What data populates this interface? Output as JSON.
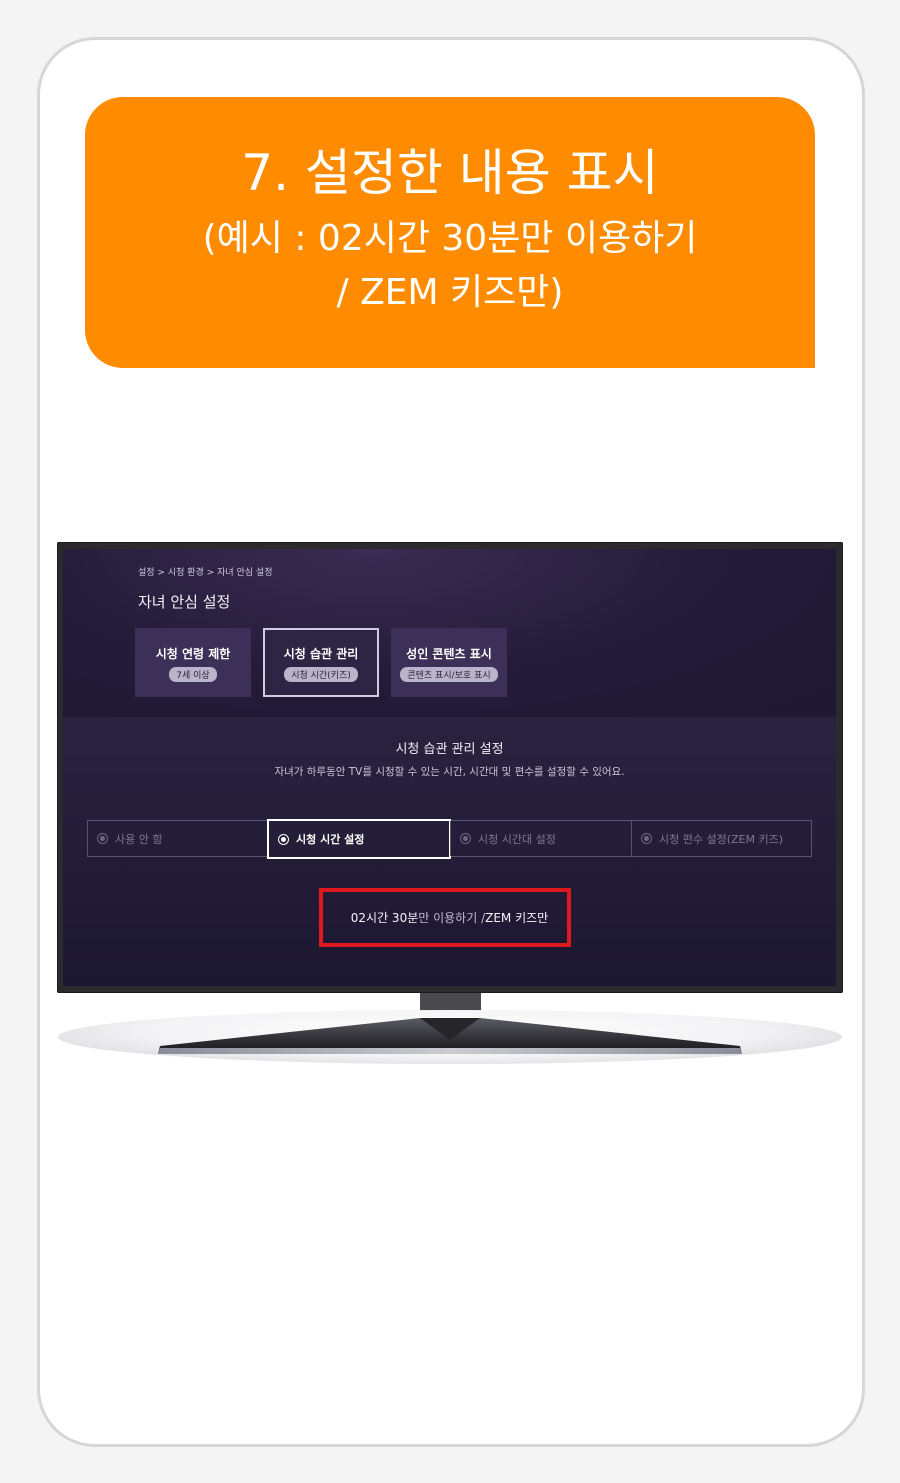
{
  "banner": {
    "line1": "7. 설정한 내용 표시",
    "line2": "(예시 : 02시간 30분만 이용하기",
    "line3": "/ ZEM 키즈만)",
    "color": "#ff8c00"
  },
  "tv": {
    "breadcrumb": "설정 > 시청 환경 > 자녀 안심 설정",
    "page_title": "자녀 안심 설정",
    "categories": [
      {
        "label": "시청 연령 제한",
        "sub": "7세 이상"
      },
      {
        "label": "시청 습관 관리",
        "sub": "시청 시간(키즈)"
      },
      {
        "label": "성인 콘텐츠 표시",
        "sub": "콘텐츠 표시/보호 표시"
      }
    ],
    "section_title": "시청 습관 관리 설정",
    "section_desc": "자녀가 하루동안 TV를 시청할 수 있는 시간, 시간대 및 편수를 설정할 수 있어요.",
    "options": [
      "사용 안 함",
      "시청 시간 설정",
      "시청 시간대 설정",
      "시청 편수 설정(ZEM 키즈)"
    ],
    "result_highlight": "02시간 30분",
    "result_rest": "만 이용하기 /",
    "result_zem": "ZEM 키즈만",
    "highlight_color": "#e0191e"
  }
}
